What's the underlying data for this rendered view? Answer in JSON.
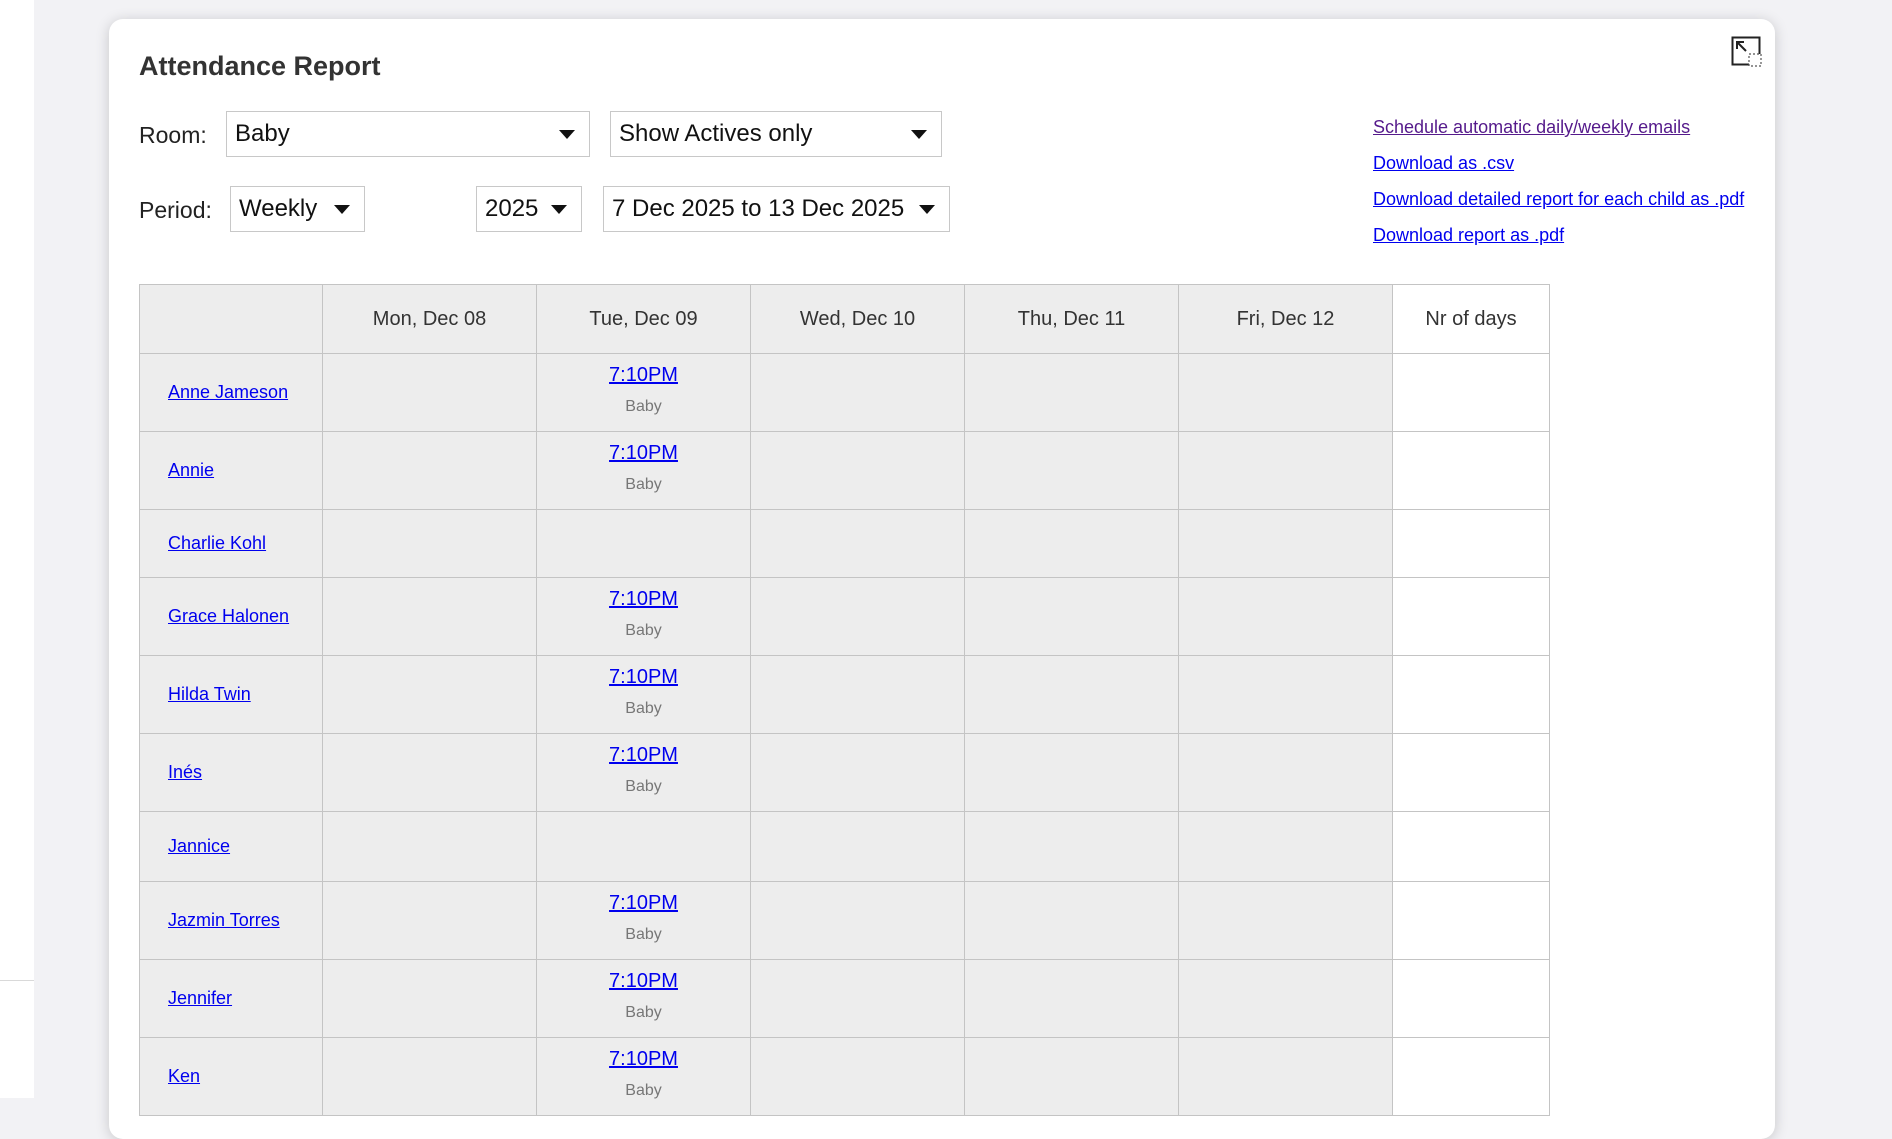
{
  "modal": {
    "title": "Attendance Report",
    "collapse_icon": "collapse-arrows-icon"
  },
  "filters": {
    "room_label": "Room:",
    "room_value": "Baby",
    "active_filter_value": "Show Actives only",
    "period_label": "Period:",
    "period_value": "Weekly",
    "year_value": "2025",
    "range_value": "7 Dec 2025 to 13 Dec 2025"
  },
  "links": {
    "schedule": "Schedule automatic daily/weekly emails",
    "csv": "Download as .csv",
    "detailed_pdf": "Download detailed report for each child as .pdf",
    "report_pdf": "Download report as .pdf"
  },
  "table": {
    "headers": [
      "",
      "Mon, Dec 08",
      "Tue, Dec 09",
      "Wed, Dec 10",
      "Thu, Dec 11",
      "Fri, Dec 12",
      "Nr of days"
    ],
    "rows": [
      {
        "name": "Anne Jameson",
        "tue_time": "7:10PM",
        "tue_room": "Baby"
      },
      {
        "name": "Annie",
        "tue_time": "7:10PM",
        "tue_room": "Baby"
      },
      {
        "name": "Charlie Kohl",
        "tue_time": "",
        "tue_room": ""
      },
      {
        "name": "Grace Halonen",
        "tue_time": "7:10PM",
        "tue_room": "Baby"
      },
      {
        "name": "Hilda Twin",
        "tue_time": "7:10PM",
        "tue_room": "Baby"
      },
      {
        "name": "Inés",
        "tue_time": "7:10PM",
        "tue_room": "Baby"
      },
      {
        "name": "Jannice",
        "tue_time": "",
        "tue_room": ""
      },
      {
        "name": "Jazmin Torres",
        "tue_time": "7:10PM",
        "tue_room": "Baby"
      },
      {
        "name": "Jennifer",
        "tue_time": "7:10PM",
        "tue_room": "Baby"
      },
      {
        "name": "Ken",
        "tue_time": "7:10PM",
        "tue_room": "Baby"
      }
    ]
  }
}
